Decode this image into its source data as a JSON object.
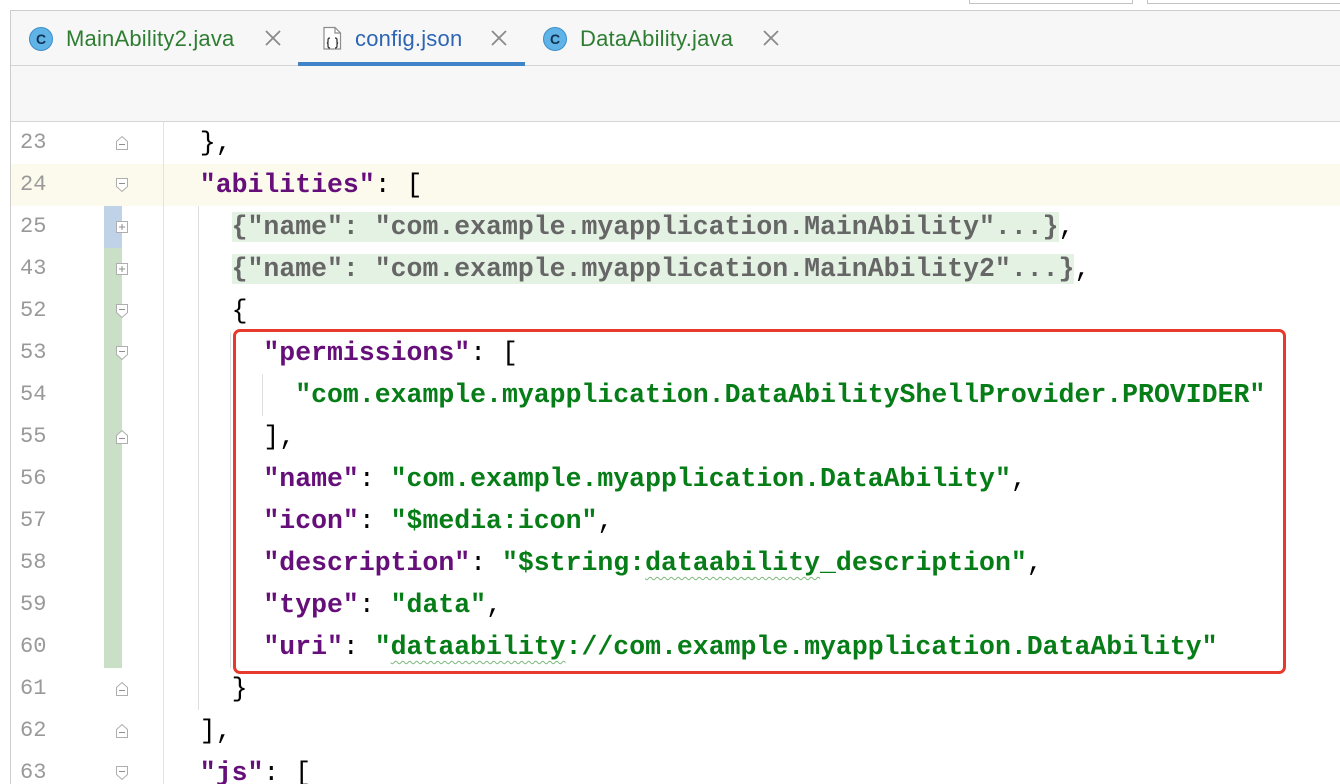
{
  "tabs": [
    {
      "label": "MainAbility2.java",
      "icon": "java-class-icon",
      "icon_letter": "C",
      "selected": false,
      "label_color": "#2e7d32"
    },
    {
      "label": "config.json",
      "icon": "json-file-icon",
      "selected": true,
      "label_color": "#2d65b3"
    },
    {
      "label": "DataAbility.java",
      "icon": "java-class-icon",
      "icon_letter": "C",
      "selected": false,
      "label_color": "#2e7d32"
    }
  ],
  "editor": {
    "caret_line": 24,
    "lines": [
      {
        "number": 23,
        "fold_icon": "fold-end-icon",
        "vcs_marker": null,
        "tokens": [
          {
            "type": "punct",
            "v": "},"
          }
        ]
      },
      {
        "number": 24,
        "fold_icon": "fold-start-icon",
        "vcs_marker": null,
        "tokens": [
          {
            "type": "key",
            "v": "\"abilities\""
          },
          {
            "type": "punct",
            "v": ": ["
          }
        ]
      },
      {
        "number": 25,
        "fold_icon": "fold-expand-icon",
        "vcs_marker": "vcs-modified-marker",
        "tokens": [
          {
            "type": "folded",
            "v": "{\"name\": \"com.example.myapplication.MainAbility\"...}"
          },
          {
            "type": "punct",
            "v": ","
          }
        ]
      },
      {
        "number": 43,
        "fold_icon": "fold-expand-icon",
        "vcs_marker": "vcs-added-marker",
        "tokens": [
          {
            "type": "folded",
            "v": "{\"name\": \"com.example.myapplication.MainAbility2\"...}"
          },
          {
            "type": "punct",
            "v": ","
          }
        ]
      },
      {
        "number": 52,
        "fold_icon": "fold-start-icon",
        "vcs_marker": "vcs-added-marker",
        "tokens": [
          {
            "type": "punct",
            "v": "{"
          }
        ]
      },
      {
        "number": 53,
        "fold_icon": "fold-start-icon",
        "vcs_marker": "vcs-added-marker",
        "tokens": [
          {
            "type": "key",
            "v": "\"permissions\""
          },
          {
            "type": "punct",
            "v": ": ["
          }
        ]
      },
      {
        "number": 54,
        "fold_icon": null,
        "vcs_marker": "vcs-added-marker",
        "tokens": [
          {
            "type": "string",
            "v": "\"com.example.myapplication.DataAbilityShellProvider.PROVIDER\""
          }
        ]
      },
      {
        "number": 55,
        "fold_icon": "fold-end-icon",
        "vcs_marker": "vcs-added-marker",
        "tokens": [
          {
            "type": "punct",
            "v": "],"
          }
        ]
      },
      {
        "number": 56,
        "fold_icon": null,
        "vcs_marker": "vcs-added-marker",
        "tokens": [
          {
            "type": "key",
            "v": "\"name\""
          },
          {
            "type": "punct",
            "v": ": "
          },
          {
            "type": "string",
            "v": "\"com.example.myapplication.DataAbility\""
          },
          {
            "type": "punct",
            "v": ","
          }
        ]
      },
      {
        "number": 57,
        "fold_icon": null,
        "vcs_marker": "vcs-added-marker",
        "tokens": [
          {
            "type": "key",
            "v": "\"icon\""
          },
          {
            "type": "punct",
            "v": ": "
          },
          {
            "type": "string",
            "v": "\"$media:icon\""
          },
          {
            "type": "punct",
            "v": ","
          }
        ]
      },
      {
        "number": 58,
        "fold_icon": null,
        "vcs_marker": "vcs-added-marker",
        "tokens": [
          {
            "type": "key",
            "v": "\"description\""
          },
          {
            "type": "punct",
            "v": ": "
          },
          {
            "type": "string",
            "v": "\"$string:"
          },
          {
            "type": "string",
            "v": "dataability",
            "spell_warning": true
          },
          {
            "type": "string",
            "v": "_description\""
          },
          {
            "type": "punct",
            "v": ","
          }
        ]
      },
      {
        "number": 59,
        "fold_icon": null,
        "vcs_marker": "vcs-added-marker",
        "tokens": [
          {
            "type": "key",
            "v": "\"type\""
          },
          {
            "type": "punct",
            "v": ": "
          },
          {
            "type": "string",
            "v": "\"data\""
          },
          {
            "type": "punct",
            "v": ","
          }
        ]
      },
      {
        "number": 60,
        "fold_icon": null,
        "vcs_marker": "vcs-added-marker",
        "tokens": [
          {
            "type": "key",
            "v": "\"uri\""
          },
          {
            "type": "punct",
            "v": ": "
          },
          {
            "type": "string",
            "v": "\""
          },
          {
            "type": "string",
            "v": "dataability",
            "spell_warning": true
          },
          {
            "type": "string",
            "v": "://com.example.myapplication.DataAbility\""
          }
        ]
      },
      {
        "number": 61,
        "fold_icon": "fold-end-icon",
        "vcs_marker": null,
        "tokens": [
          {
            "type": "punct",
            "v": "}"
          }
        ]
      },
      {
        "number": 62,
        "fold_icon": "fold-end-icon",
        "vcs_marker": null,
        "tokens": [
          {
            "type": "punct",
            "v": "],"
          }
        ]
      },
      {
        "number": 63,
        "fold_icon": "fold-start-icon",
        "vcs_marker": null,
        "tokens": [
          {
            "type": "key",
            "v": "\"js\""
          },
          {
            "type": "punct",
            "v": ": ["
          }
        ]
      }
    ]
  },
  "colors": {
    "json_key": "#660e7a",
    "json_string": "#067d17",
    "punctuation": "#000000",
    "folded_text": "#666666",
    "folded_background": "#e4f2e4",
    "line_number": "#999999",
    "caret_row": "#fcfaed",
    "vcs_added": "#c9dfc6",
    "vcs_modified": "#bfd2e8",
    "tab_accent": "#4083c9",
    "spell_warning": "#7cb87c",
    "annotation_box": "#e8392d"
  }
}
